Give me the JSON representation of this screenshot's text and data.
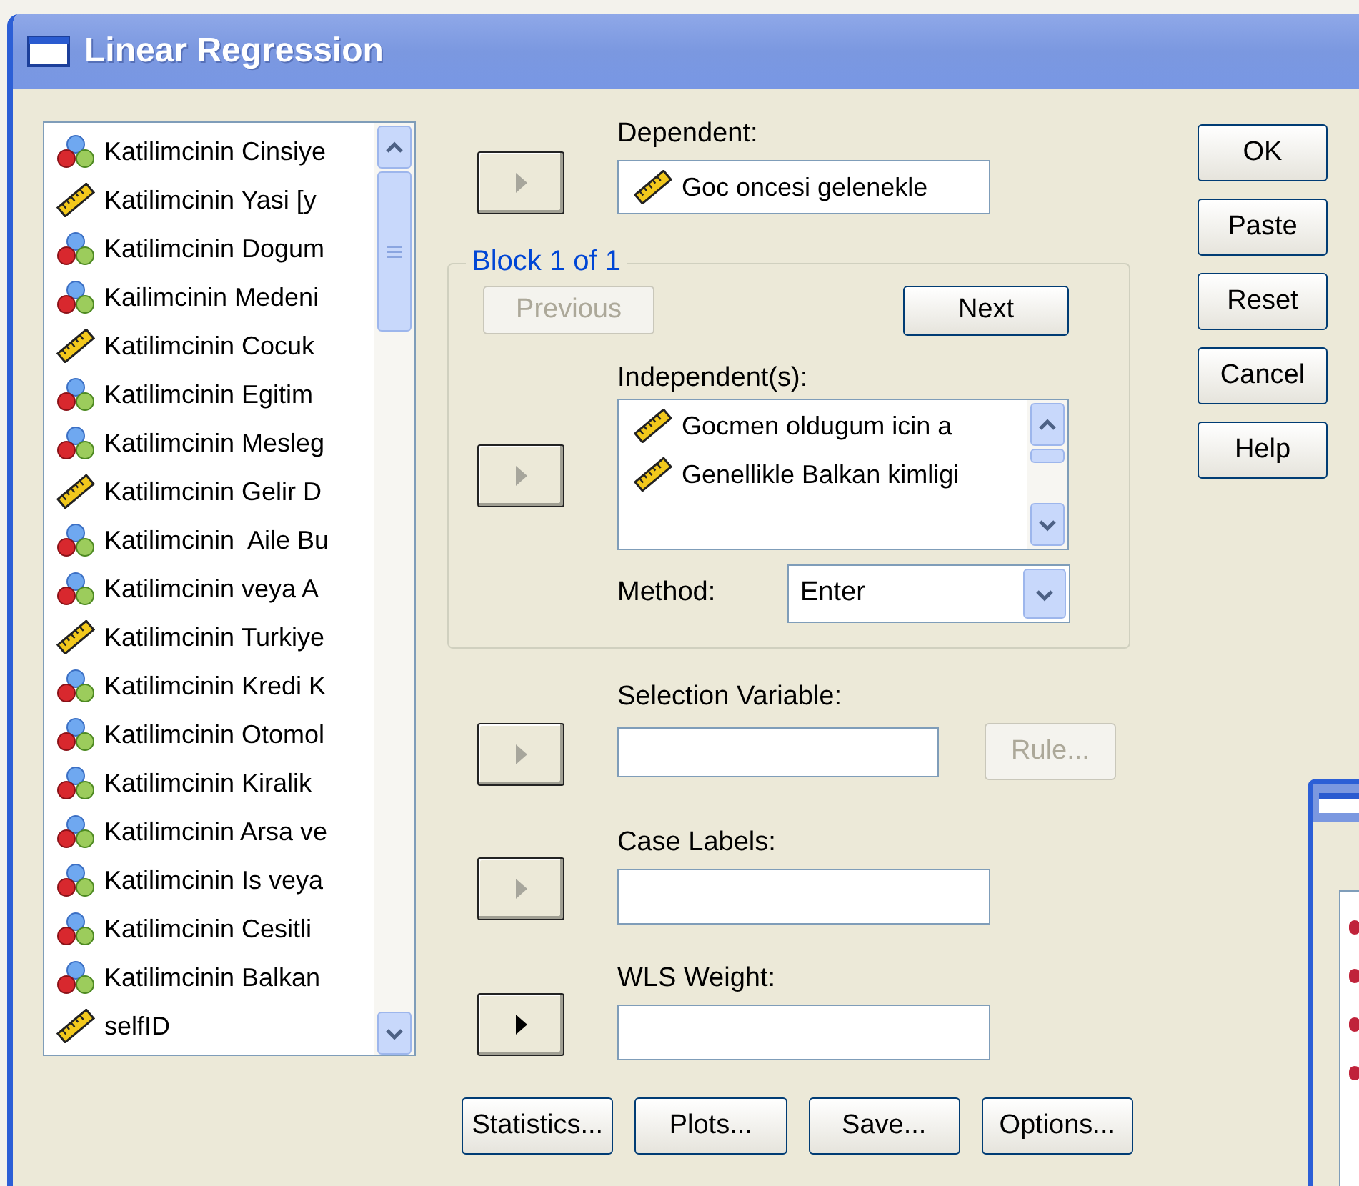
{
  "window": {
    "title": "Linear Regression"
  },
  "variables": [
    {
      "label": "Katilimcinin Cinsiye",
      "kind": "nominal"
    },
    {
      "label": "Katilimcinin Yasi [y",
      "kind": "scale"
    },
    {
      "label": "Katilimcinin Dogum",
      "kind": "nominal"
    },
    {
      "label": "Kailimcinin Medeni",
      "kind": "nominal"
    },
    {
      "label": "Katilimcinin Cocuk",
      "kind": "scale"
    },
    {
      "label": "Katilimcinin Egitim",
      "kind": "nominal"
    },
    {
      "label": "Katilimcinin Mesleg",
      "kind": "nominal"
    },
    {
      "label": "Katilimcinin Gelir D",
      "kind": "scale"
    },
    {
      "label": "Katilimcinin  Aile Bu",
      "kind": "nominal"
    },
    {
      "label": "Katilimcinin veya A",
      "kind": "nominal"
    },
    {
      "label": "Katilimcinin Turkiye",
      "kind": "scale"
    },
    {
      "label": "Katilimcinin Kredi K",
      "kind": "nominal"
    },
    {
      "label": "Katilimcinin Otomol",
      "kind": "nominal"
    },
    {
      "label": "Katilimcinin Kiralik",
      "kind": "nominal"
    },
    {
      "label": "Katilimcinin Arsa ve",
      "kind": "nominal"
    },
    {
      "label": "Katilimcinin Is veya",
      "kind": "nominal"
    },
    {
      "label": "Katilimcinin Cesitli",
      "kind": "nominal"
    },
    {
      "label": "Katilimcinin Balkan",
      "kind": "nominal"
    },
    {
      "label": "selfID",
      "kind": "scale"
    }
  ],
  "dependent": {
    "label": "Dependent:",
    "arrow_disabled": true,
    "items": [
      {
        "label": "Goc oncesi gelenekle",
        "kind": "scale"
      }
    ]
  },
  "block": {
    "title": "Block 1 of 1",
    "previous": {
      "label": "Previous",
      "disabled": true
    },
    "next": {
      "label": "Next",
      "disabled": false
    },
    "independents": {
      "label": "Independent(s):",
      "arrow_disabled": true,
      "items": [
        {
          "label": "Gocmen oldugum icin a",
          "kind": "scale"
        },
        {
          "label": "Genellikle Balkan kimligi",
          "kind": "scale"
        }
      ]
    },
    "method": {
      "label": "Method:",
      "value": "Enter"
    }
  },
  "selection_variable": {
    "label": "Selection Variable:",
    "arrow_disabled": true,
    "rule": {
      "label": "Rule...",
      "disabled": true
    }
  },
  "case_labels": {
    "label": "Case Labels:",
    "arrow_disabled": true
  },
  "wls_weight": {
    "label": "WLS Weight:",
    "arrow_disabled": false
  },
  "bottom_buttons": [
    {
      "label": "Statistics...",
      "disabled": false
    },
    {
      "label": "Plots...",
      "disabled": false
    },
    {
      "label": "Save...",
      "disabled": false
    },
    {
      "label": "Options...",
      "disabled": false
    }
  ],
  "side_buttons": [
    {
      "label": "OK",
      "disabled": false
    },
    {
      "label": "Paste",
      "disabled": false
    },
    {
      "label": "Reset",
      "disabled": false
    },
    {
      "label": "Cancel",
      "disabled": false
    },
    {
      "label": "Help",
      "disabled": false
    }
  ]
}
